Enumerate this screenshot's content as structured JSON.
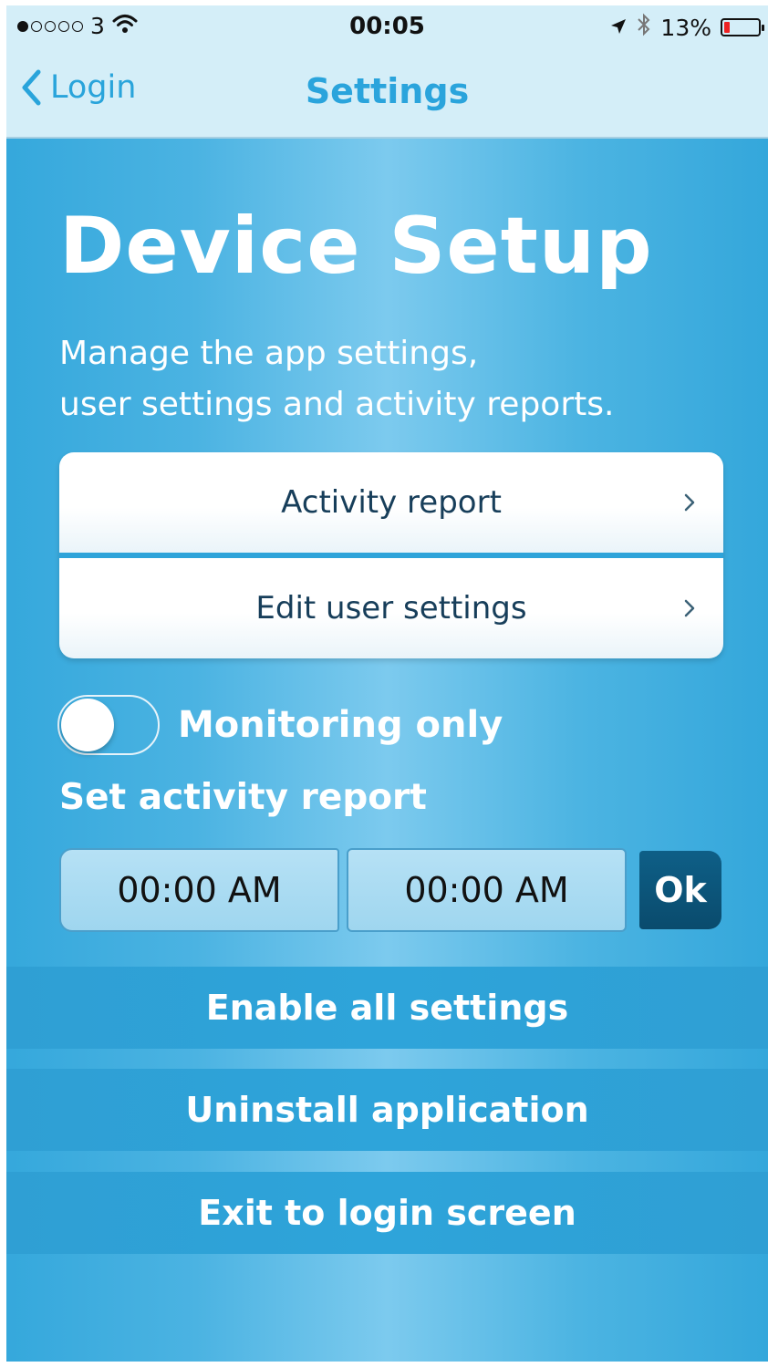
{
  "status_bar": {
    "carrier": "3",
    "time": "00:05",
    "battery_percent": "13%",
    "signal_icon": "signal-dots",
    "wifi_icon": "wifi-icon",
    "location_icon": "location-arrow-icon",
    "bluetooth_icon": "bluetooth-icon",
    "battery_level": 0.13,
    "battery_color": "#e22222"
  },
  "nav": {
    "back_label": "Login",
    "title": "Settings"
  },
  "header": {
    "title": "Device Setup",
    "subtitle_line1": "Manage the app settings,",
    "subtitle_line2": "user settings and activity reports."
  },
  "menu": {
    "items": [
      {
        "label": "Activity report"
      },
      {
        "label": "Edit user settings"
      }
    ]
  },
  "toggle": {
    "label": "Monitoring only",
    "state": "off"
  },
  "activity_report": {
    "label": "Set activity report",
    "start_time": "00:00 AM",
    "end_time": "00:00 AM",
    "ok_label": "Ok"
  },
  "actions": {
    "enable_all": "Enable all settings",
    "uninstall": "Uninstall application",
    "exit": "Exit to login screen"
  },
  "colors": {
    "accent": "#29a4db",
    "ok_button": "#0a4b6d",
    "text_dark": "#173e5a"
  }
}
